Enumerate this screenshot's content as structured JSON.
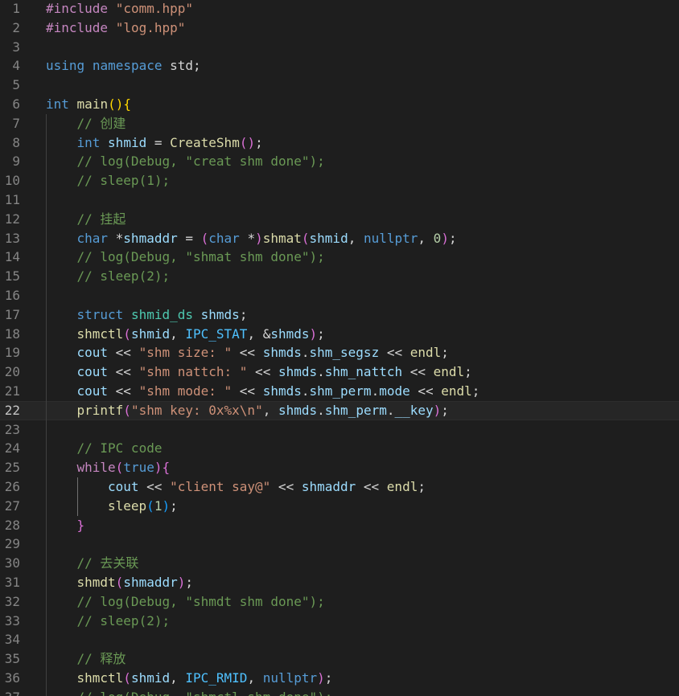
{
  "editor": {
    "language": "cpp",
    "current_line": 22,
    "colors": {
      "background": "#1e1e1e",
      "line_number": "#858585",
      "keyword": "#569cd6",
      "string": "#ce9178",
      "comment": "#6a9955",
      "function": "#dcdcaa",
      "type": "#4ec9b0"
    },
    "lines": [
      {
        "n": "1",
        "indent": 0,
        "tokens": [
          [
            "#include ",
            "pp"
          ],
          [
            "\"comm.hpp\"",
            "st"
          ]
        ]
      },
      {
        "n": "2",
        "indent": 0,
        "tokens": [
          [
            "#include ",
            "pp"
          ],
          [
            "\"log.hpp\"",
            "st"
          ]
        ]
      },
      {
        "n": "3",
        "indent": 0,
        "tokens": []
      },
      {
        "n": "4",
        "indent": 0,
        "tokens": [
          [
            "using",
            "kw"
          ],
          [
            " ",
            "def"
          ],
          [
            "namespace",
            "kw"
          ],
          [
            " std;",
            "def"
          ]
        ]
      },
      {
        "n": "5",
        "indent": 0,
        "tokens": []
      },
      {
        "n": "6",
        "indent": 0,
        "tokens": [
          [
            "int",
            "kw"
          ],
          [
            " ",
            "def"
          ],
          [
            "main",
            "fn"
          ],
          [
            "()",
            "br1"
          ],
          [
            "{",
            "br1"
          ]
        ]
      },
      {
        "n": "7",
        "indent": 1,
        "tokens": [
          [
            "// 创建",
            "cm"
          ]
        ]
      },
      {
        "n": "8",
        "indent": 1,
        "tokens": [
          [
            "int",
            "kw"
          ],
          [
            " ",
            "def"
          ],
          [
            "shmid",
            "va"
          ],
          [
            " = ",
            "def"
          ],
          [
            "CreateShm",
            "fn"
          ],
          [
            "()",
            "br2"
          ],
          [
            ";",
            "def"
          ]
        ]
      },
      {
        "n": "9",
        "indent": 1,
        "tokens": [
          [
            "// log(Debug, \"creat shm done\");",
            "cm"
          ]
        ]
      },
      {
        "n": "10",
        "indent": 1,
        "tokens": [
          [
            "// sleep(1);",
            "cm"
          ]
        ]
      },
      {
        "n": "11",
        "indent": 1,
        "tokens": []
      },
      {
        "n": "12",
        "indent": 1,
        "tokens": [
          [
            "// 挂起",
            "cm"
          ]
        ]
      },
      {
        "n": "13",
        "indent": 1,
        "tokens": [
          [
            "char",
            "kw"
          ],
          [
            " *",
            "def"
          ],
          [
            "shmaddr",
            "va"
          ],
          [
            " = ",
            "def"
          ],
          [
            "(",
            "br2"
          ],
          [
            "char",
            "kw"
          ],
          [
            " *",
            "def"
          ],
          [
            ")",
            "br2"
          ],
          [
            "shmat",
            "fn"
          ],
          [
            "(",
            "br2"
          ],
          [
            "shmid",
            "va"
          ],
          [
            ", ",
            "def"
          ],
          [
            "nullptr",
            "kw"
          ],
          [
            ", ",
            "def"
          ],
          [
            "0",
            "nu"
          ],
          [
            ")",
            "br2"
          ],
          [
            ";",
            "def"
          ]
        ]
      },
      {
        "n": "14",
        "indent": 1,
        "tokens": [
          [
            "// log(Debug, \"shmat shm done\");",
            "cm"
          ]
        ]
      },
      {
        "n": "15",
        "indent": 1,
        "tokens": [
          [
            "// sleep(2);",
            "cm"
          ]
        ]
      },
      {
        "n": "16",
        "indent": 1,
        "tokens": []
      },
      {
        "n": "17",
        "indent": 1,
        "tokens": [
          [
            "struct",
            "kw"
          ],
          [
            " ",
            "def"
          ],
          [
            "shmid_ds",
            "ty"
          ],
          [
            " ",
            "def"
          ],
          [
            "shmds",
            "va"
          ],
          [
            ";",
            "def"
          ]
        ]
      },
      {
        "n": "18",
        "indent": 1,
        "tokens": [
          [
            "shmctl",
            "fn"
          ],
          [
            "(",
            "br2"
          ],
          [
            "shmid",
            "va"
          ],
          [
            ", ",
            "def"
          ],
          [
            "IPC_STAT",
            "mc"
          ],
          [
            ", &",
            "def"
          ],
          [
            "shmds",
            "va"
          ],
          [
            ")",
            "br2"
          ],
          [
            ";",
            "def"
          ]
        ]
      },
      {
        "n": "19",
        "indent": 1,
        "tokens": [
          [
            "cout",
            "va"
          ],
          [
            " << ",
            "def"
          ],
          [
            "\"shm size: \"",
            "st"
          ],
          [
            " << ",
            "def"
          ],
          [
            "shmds",
            "va"
          ],
          [
            ".",
            "def"
          ],
          [
            "shm_segsz",
            "va"
          ],
          [
            " << ",
            "def"
          ],
          [
            "endl",
            "fn"
          ],
          [
            ";",
            "def"
          ]
        ]
      },
      {
        "n": "20",
        "indent": 1,
        "tokens": [
          [
            "cout",
            "va"
          ],
          [
            " << ",
            "def"
          ],
          [
            "\"shm nattch: \"",
            "st"
          ],
          [
            " << ",
            "def"
          ],
          [
            "shmds",
            "va"
          ],
          [
            ".",
            "def"
          ],
          [
            "shm_nattch",
            "va"
          ],
          [
            " << ",
            "def"
          ],
          [
            "endl",
            "fn"
          ],
          [
            ";",
            "def"
          ]
        ]
      },
      {
        "n": "21",
        "indent": 1,
        "tokens": [
          [
            "cout",
            "va"
          ],
          [
            " << ",
            "def"
          ],
          [
            "\"shm mode: \"",
            "st"
          ],
          [
            " << ",
            "def"
          ],
          [
            "shmds",
            "va"
          ],
          [
            ".",
            "def"
          ],
          [
            "shm_perm",
            "va"
          ],
          [
            ".",
            "def"
          ],
          [
            "mode",
            "va"
          ],
          [
            " << ",
            "def"
          ],
          [
            "endl",
            "fn"
          ],
          [
            ";",
            "def"
          ]
        ]
      },
      {
        "n": "22",
        "indent": 1,
        "tokens": [
          [
            "printf",
            "fn"
          ],
          [
            "(",
            "br2"
          ],
          [
            "\"shm key: 0x%x\\n\"",
            "st"
          ],
          [
            ", ",
            "def"
          ],
          [
            "shmds",
            "va"
          ],
          [
            ".",
            "def"
          ],
          [
            "shm_perm",
            "va"
          ],
          [
            ".",
            "def"
          ],
          [
            "__key",
            "va"
          ],
          [
            ")",
            "br2"
          ],
          [
            ";",
            "def"
          ]
        ]
      },
      {
        "n": "23",
        "indent": 1,
        "tokens": []
      },
      {
        "n": "24",
        "indent": 1,
        "tokens": [
          [
            "// IPC code",
            "cm"
          ]
        ]
      },
      {
        "n": "25",
        "indent": 1,
        "tokens": [
          [
            "while",
            "ctl"
          ],
          [
            "(",
            "br2"
          ],
          [
            "true",
            "kw"
          ],
          [
            ")",
            "br2"
          ],
          [
            "{",
            "br2"
          ]
        ]
      },
      {
        "n": "26",
        "indent": 2,
        "tokens": [
          [
            "cout",
            "va"
          ],
          [
            " << ",
            "def"
          ],
          [
            "\"client say@\"",
            "st"
          ],
          [
            " << ",
            "def"
          ],
          [
            "shmaddr",
            "va"
          ],
          [
            " << ",
            "def"
          ],
          [
            "endl",
            "fn"
          ],
          [
            ";",
            "def"
          ]
        ]
      },
      {
        "n": "27",
        "indent": 2,
        "tokens": [
          [
            "sleep",
            "fn"
          ],
          [
            "(",
            "br3"
          ],
          [
            "1",
            "nu"
          ],
          [
            ")",
            "br3"
          ],
          [
            ";",
            "def"
          ]
        ]
      },
      {
        "n": "28",
        "indent": 1,
        "tokens": [
          [
            "}",
            "br2"
          ]
        ]
      },
      {
        "n": "29",
        "indent": 1,
        "tokens": []
      },
      {
        "n": "30",
        "indent": 1,
        "tokens": [
          [
            "// 去关联",
            "cm"
          ]
        ]
      },
      {
        "n": "31",
        "indent": 1,
        "tokens": [
          [
            "shmdt",
            "fn"
          ],
          [
            "(",
            "br2"
          ],
          [
            "shmaddr",
            "va"
          ],
          [
            ")",
            "br2"
          ],
          [
            ";",
            "def"
          ]
        ]
      },
      {
        "n": "32",
        "indent": 1,
        "tokens": [
          [
            "// log(Debug, \"shmdt shm done\");",
            "cm"
          ]
        ]
      },
      {
        "n": "33",
        "indent": 1,
        "tokens": [
          [
            "// sleep(2);",
            "cm"
          ]
        ]
      },
      {
        "n": "34",
        "indent": 1,
        "tokens": []
      },
      {
        "n": "35",
        "indent": 1,
        "tokens": [
          [
            "// 释放",
            "cm"
          ]
        ]
      },
      {
        "n": "36",
        "indent": 1,
        "tokens": [
          [
            "shmctl",
            "fn"
          ],
          [
            "(",
            "br2"
          ],
          [
            "shmid",
            "va"
          ],
          [
            ", ",
            "def"
          ],
          [
            "IPC_RMID",
            "mc"
          ],
          [
            ", ",
            "def"
          ],
          [
            "nullptr",
            "kw"
          ],
          [
            ")",
            "br2"
          ],
          [
            ";",
            "def"
          ]
        ]
      },
      {
        "n": "37",
        "indent": 1,
        "tokens": [
          [
            "// log(Debug, \"shmctl shm done\");",
            "cm"
          ]
        ]
      }
    ]
  }
}
